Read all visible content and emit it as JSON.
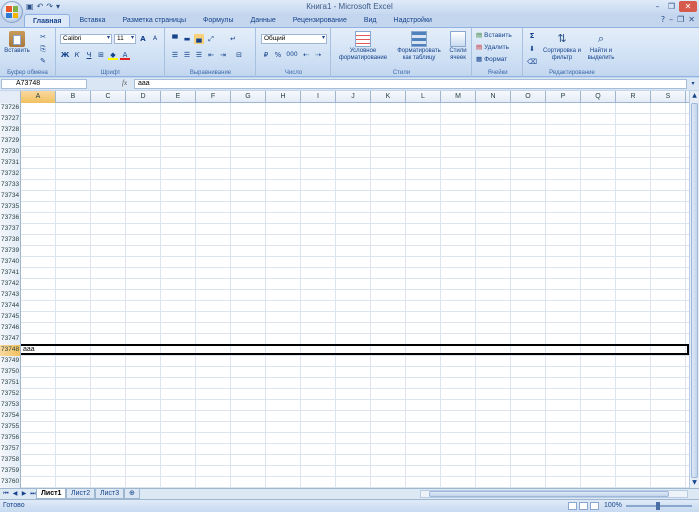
{
  "app": {
    "window_title": "Книга1 - Microsoft Excel",
    "qat_icons": [
      "save-icon",
      "undo-icon",
      "redo-icon",
      "customize-icon"
    ]
  },
  "tabs": [
    "Главная",
    "Вставка",
    "Разметка страницы",
    "Формулы",
    "Данные",
    "Рецензирование",
    "Вид",
    "Надстройки"
  ],
  "ribbon": {
    "clipboard": {
      "label": "Буфер обмена",
      "paste": "Вставить"
    },
    "font": {
      "label": "Шрифт",
      "font_name": "Calibri",
      "font_size": "11",
      "bold": "Ж",
      "italic": "К",
      "underline": "Ч",
      "grow": "A",
      "shrink": "A"
    },
    "alignment": {
      "label": "Выравнивание"
    },
    "number": {
      "label": "Число",
      "format": "Общий",
      "percent": "%",
      "thousands": "000"
    },
    "styles": {
      "label": "Стили",
      "conditional": "Условное форматирование",
      "as_table": "Форматировать как таблицу",
      "cell_styles": "Стили ячеек"
    },
    "cells": {
      "label": "Ячейки",
      "insert": "Вставить",
      "delete": "Удалить",
      "format": "Формат"
    },
    "editing": {
      "label": "Редактирование",
      "sort": "Сортировка и фильтр",
      "find": "Найти и выделить",
      "sum": "Σ"
    }
  },
  "formula_bar": {
    "name_box": "A73748",
    "fx": "fx",
    "value": "aaa"
  },
  "columns": [
    "A",
    "B",
    "C",
    "D",
    "E",
    "F",
    "G",
    "H",
    "I",
    "J",
    "K",
    "L",
    "M",
    "N",
    "O",
    "P",
    "Q",
    "R",
    "S"
  ],
  "rows": [
    "73726",
    "73727",
    "73728",
    "73729",
    "73730",
    "73731",
    "73732",
    "73733",
    "73734",
    "73735",
    "73736",
    "73737",
    "73738",
    "73739",
    "73740",
    "73741",
    "73742",
    "73743",
    "73744",
    "73745",
    "73746",
    "73747",
    "73748",
    "73749",
    "73750",
    "73751",
    "73752",
    "73753",
    "73754",
    "73755",
    "73756",
    "73757",
    "73758",
    "73759",
    "73760"
  ],
  "selected_row": "73748",
  "selected_cell_value": "aaa",
  "sheets": [
    "Лист1",
    "Лист2",
    "Лист3"
  ],
  "status": {
    "ready": "Готово",
    "zoom": "100%"
  }
}
